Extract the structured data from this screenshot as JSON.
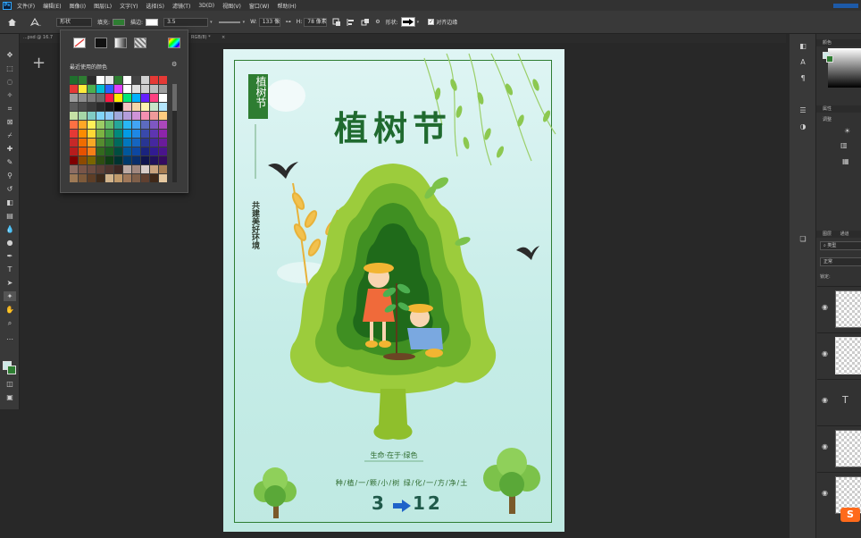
{
  "app": {
    "logo": "Ps"
  },
  "menu": [
    "文件(F)",
    "编辑(E)",
    "图像(I)",
    "图层(L)",
    "文字(Y)",
    "选择(S)",
    "滤镜(T)",
    "3D(D)",
    "视图(V)",
    "窗口(W)",
    "帮助(H)"
  ],
  "options": {
    "mode": "形状",
    "fill_label": "填充:",
    "stroke_label": "描边:",
    "stroke_width": "3.5",
    "w_label": "W:",
    "w_value": "133 像",
    "h_label": "H:",
    "h_value": "78 像素",
    "shape_label": "形状:",
    "align_label": "对齐边缘",
    "fill_color": "#2e7d32"
  },
  "tabs": {
    "doc1": "...psd @ 16.7",
    "doc2": "RGB/8) *",
    "close": "×"
  },
  "swatch_popup": {
    "title": "最近使用的颜色",
    "rows": [
      [
        "#1f6f2d",
        "#2e7d32",
        "#2b2b2b",
        "#ffffff",
        "#e8e8e8",
        "#2e7d32",
        "#ffffff",
        "#444444",
        "#d0d0d0",
        "#e53935",
        "#e53935"
      ],
      [
        "#e53935",
        "#ffeb3b",
        "#4caf50",
        "#00bcd4",
        "#2962ff",
        "#e040fb",
        "#ffffff",
        "#e0e0e0",
        "#cfcfcf",
        "#bdbdbd",
        "#9e9e9e"
      ],
      [
        "#9e9e9e",
        "#8c8c8c",
        "#7a7a7a",
        "#6a6a6a",
        "#ff1744",
        "#ffea00",
        "#00e676",
        "#00b0ff",
        "#651fff",
        "#ff4081",
        "#ffffff"
      ],
      [
        "#5a5a5a",
        "#4a4a4a",
        "#3a3a3a",
        "#2a2a2a",
        "#1a1a1a",
        "#000000",
        "#f4c2c2",
        "#f6d6a8",
        "#fff3b0",
        "#c8e6c9",
        "#b3e5fc"
      ],
      [
        "#c5e1a5",
        "#a5d6a7",
        "#80cbc4",
        "#81d4fa",
        "#90caf9",
        "#9fa8da",
        "#b39ddb",
        "#ce93d8",
        "#f48fb1",
        "#ef9a9a",
        "#ffcc80"
      ],
      [
        "#ff7043",
        "#ffa726",
        "#ffee58",
        "#9ccc65",
        "#66bb6a",
        "#26a69a",
        "#29b6f6",
        "#42a5f5",
        "#5c6bc0",
        "#7e57c2",
        "#ab47bc"
      ],
      [
        "#e53935",
        "#fb8c00",
        "#fdd835",
        "#7cb342",
        "#43a047",
        "#00897b",
        "#039be5",
        "#1e88e5",
        "#3949ab",
        "#5e35b1",
        "#8e24aa"
      ],
      [
        "#c62828",
        "#ef6c00",
        "#f9a825",
        "#558b2f",
        "#2e7d32",
        "#00695c",
        "#0277bd",
        "#1565c0",
        "#283593",
        "#4527a0",
        "#6a1b9a"
      ],
      [
        "#b71c1c",
        "#e65100",
        "#f57f17",
        "#33691e",
        "#1b5e20",
        "#004d40",
        "#01579b",
        "#0d47a1",
        "#1a237e",
        "#311b92",
        "#4a148c"
      ],
      [
        "#7f0000",
        "#8d4a00",
        "#7a6500",
        "#2e4d12",
        "#103d14",
        "#003330",
        "#013a6b",
        "#0a2e6b",
        "#10154f",
        "#21125c",
        "#360b60"
      ],
      [
        "#8d6e63",
        "#795548",
        "#6d4c41",
        "#5d4037",
        "#4e342e",
        "#3e2723",
        "#bcaaa4",
        "#a1887f",
        "#d7ccc8",
        "#c9a27e",
        "#a67c52"
      ],
      [
        "#9e7a56",
        "#7e5a3a",
        "#5e3e26",
        "#3e2a1a",
        "#d2b48c",
        "#c19a6b",
        "#a0785a",
        "#80604a",
        "#604030",
        "#402818",
        "#e6c8a0"
      ]
    ]
  },
  "poster": {
    "title": "植树节",
    "badge": "植树节",
    "vertical_slogan": "共建美好环境",
    "subtitle": "生命·在于·绿色",
    "slogan": "种/植/一/颗/小/树   绿/化/一/方/净/土",
    "date_left": "3",
    "date_right": "12"
  },
  "right_panel": {
    "color_tab": "颜色",
    "properties_tab": "属性",
    "adjust_tab": "调整",
    "layers_tab": "图层",
    "channels_tab": "通道",
    "kind_filter": "类型",
    "blend_mode": "正常",
    "lock_label": "锁定:"
  },
  "watermark": "S"
}
